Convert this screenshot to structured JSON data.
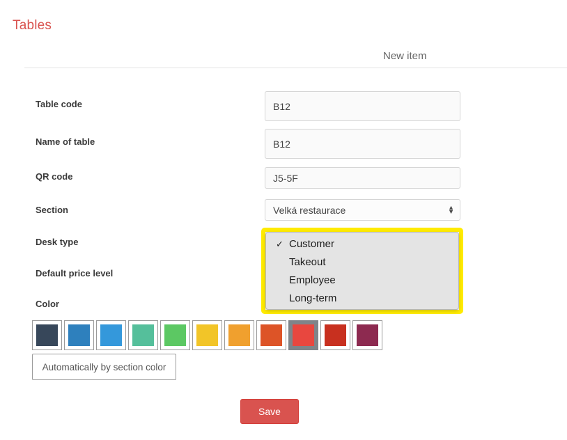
{
  "page": {
    "title": "Tables"
  },
  "panel": {
    "header_title": "New item"
  },
  "form": {
    "rows": [
      {
        "label": "Table code",
        "value": "B12",
        "type": "text"
      },
      {
        "label": "Name of table",
        "value": "B12",
        "type": "text"
      },
      {
        "label": "QR code",
        "value": "J5-5F",
        "type": "text"
      },
      {
        "label": "Section",
        "value": "Velká restaurace",
        "type": "select"
      },
      {
        "label": "Desk type",
        "value": "Customer",
        "type": "select"
      },
      {
        "label": "Default price level",
        "value": "",
        "type": "select"
      },
      {
        "label": "Color",
        "value": "",
        "type": "colors"
      }
    ]
  },
  "desk_type_dropdown": {
    "open": true,
    "highlight_color": "#ffeb00",
    "selected": "Customer",
    "check_glyph": "✓",
    "options": [
      {
        "label": "Customer",
        "checked": true
      },
      {
        "label": "Takeout",
        "checked": false
      },
      {
        "label": "Employee",
        "checked": false
      },
      {
        "label": "Long-term",
        "checked": false
      }
    ]
  },
  "colors": {
    "swatches": [
      {
        "name": "dark-slate",
        "hex": "#37475a",
        "selected": false
      },
      {
        "name": "steel-blue",
        "hex": "#2e80bd",
        "selected": false
      },
      {
        "name": "bright-blue",
        "hex": "#3498db",
        "selected": false
      },
      {
        "name": "teal-green",
        "hex": "#55bf9b",
        "selected": false
      },
      {
        "name": "green",
        "hex": "#5cc863",
        "selected": false
      },
      {
        "name": "yellow",
        "hex": "#f2c528",
        "selected": false
      },
      {
        "name": "orange",
        "hex": "#f0a02e",
        "selected": false
      },
      {
        "name": "dark-orange",
        "hex": "#dd5427",
        "selected": false
      },
      {
        "name": "coral-red",
        "hex": "#e8473f",
        "selected": true
      },
      {
        "name": "red",
        "hex": "#c8301f",
        "selected": false
      },
      {
        "name": "maroon",
        "hex": "#8d2a50",
        "selected": false
      }
    ],
    "auto_button_label": "Automatically by section color"
  },
  "actions": {
    "save_label": "Save",
    "save_color": "#d9534f"
  },
  "spinner_glyphs": {
    "up": "▲",
    "down": "▼"
  }
}
